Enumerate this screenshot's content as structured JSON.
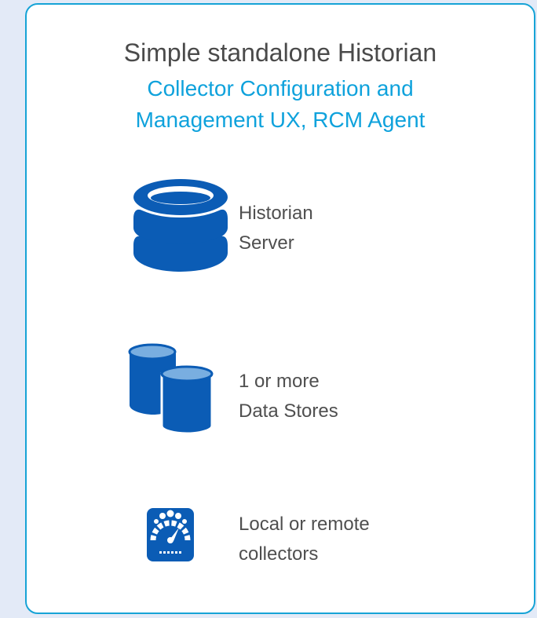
{
  "title": "Simple standalone Historian",
  "subtitle": {
    "line1": "Collector Configuration and",
    "line2": "Management UX, RCM Agent"
  },
  "items": [
    {
      "icon": "database-server-icon",
      "line1": "Historian",
      "line2": "Server"
    },
    {
      "icon": "data-stores-icon",
      "line1": "1 or more",
      "line2": "Data Stores"
    },
    {
      "icon": "collector-gauge-icon",
      "line1": "Local or remote",
      "line2": "collectors"
    }
  ],
  "colors": {
    "background": "#e3eaf7",
    "card_border": "#16a3d6",
    "subtitle": "#0fa2dc",
    "icon_blue": "#0b5cb5",
    "icon_light": "#79aee0"
  }
}
